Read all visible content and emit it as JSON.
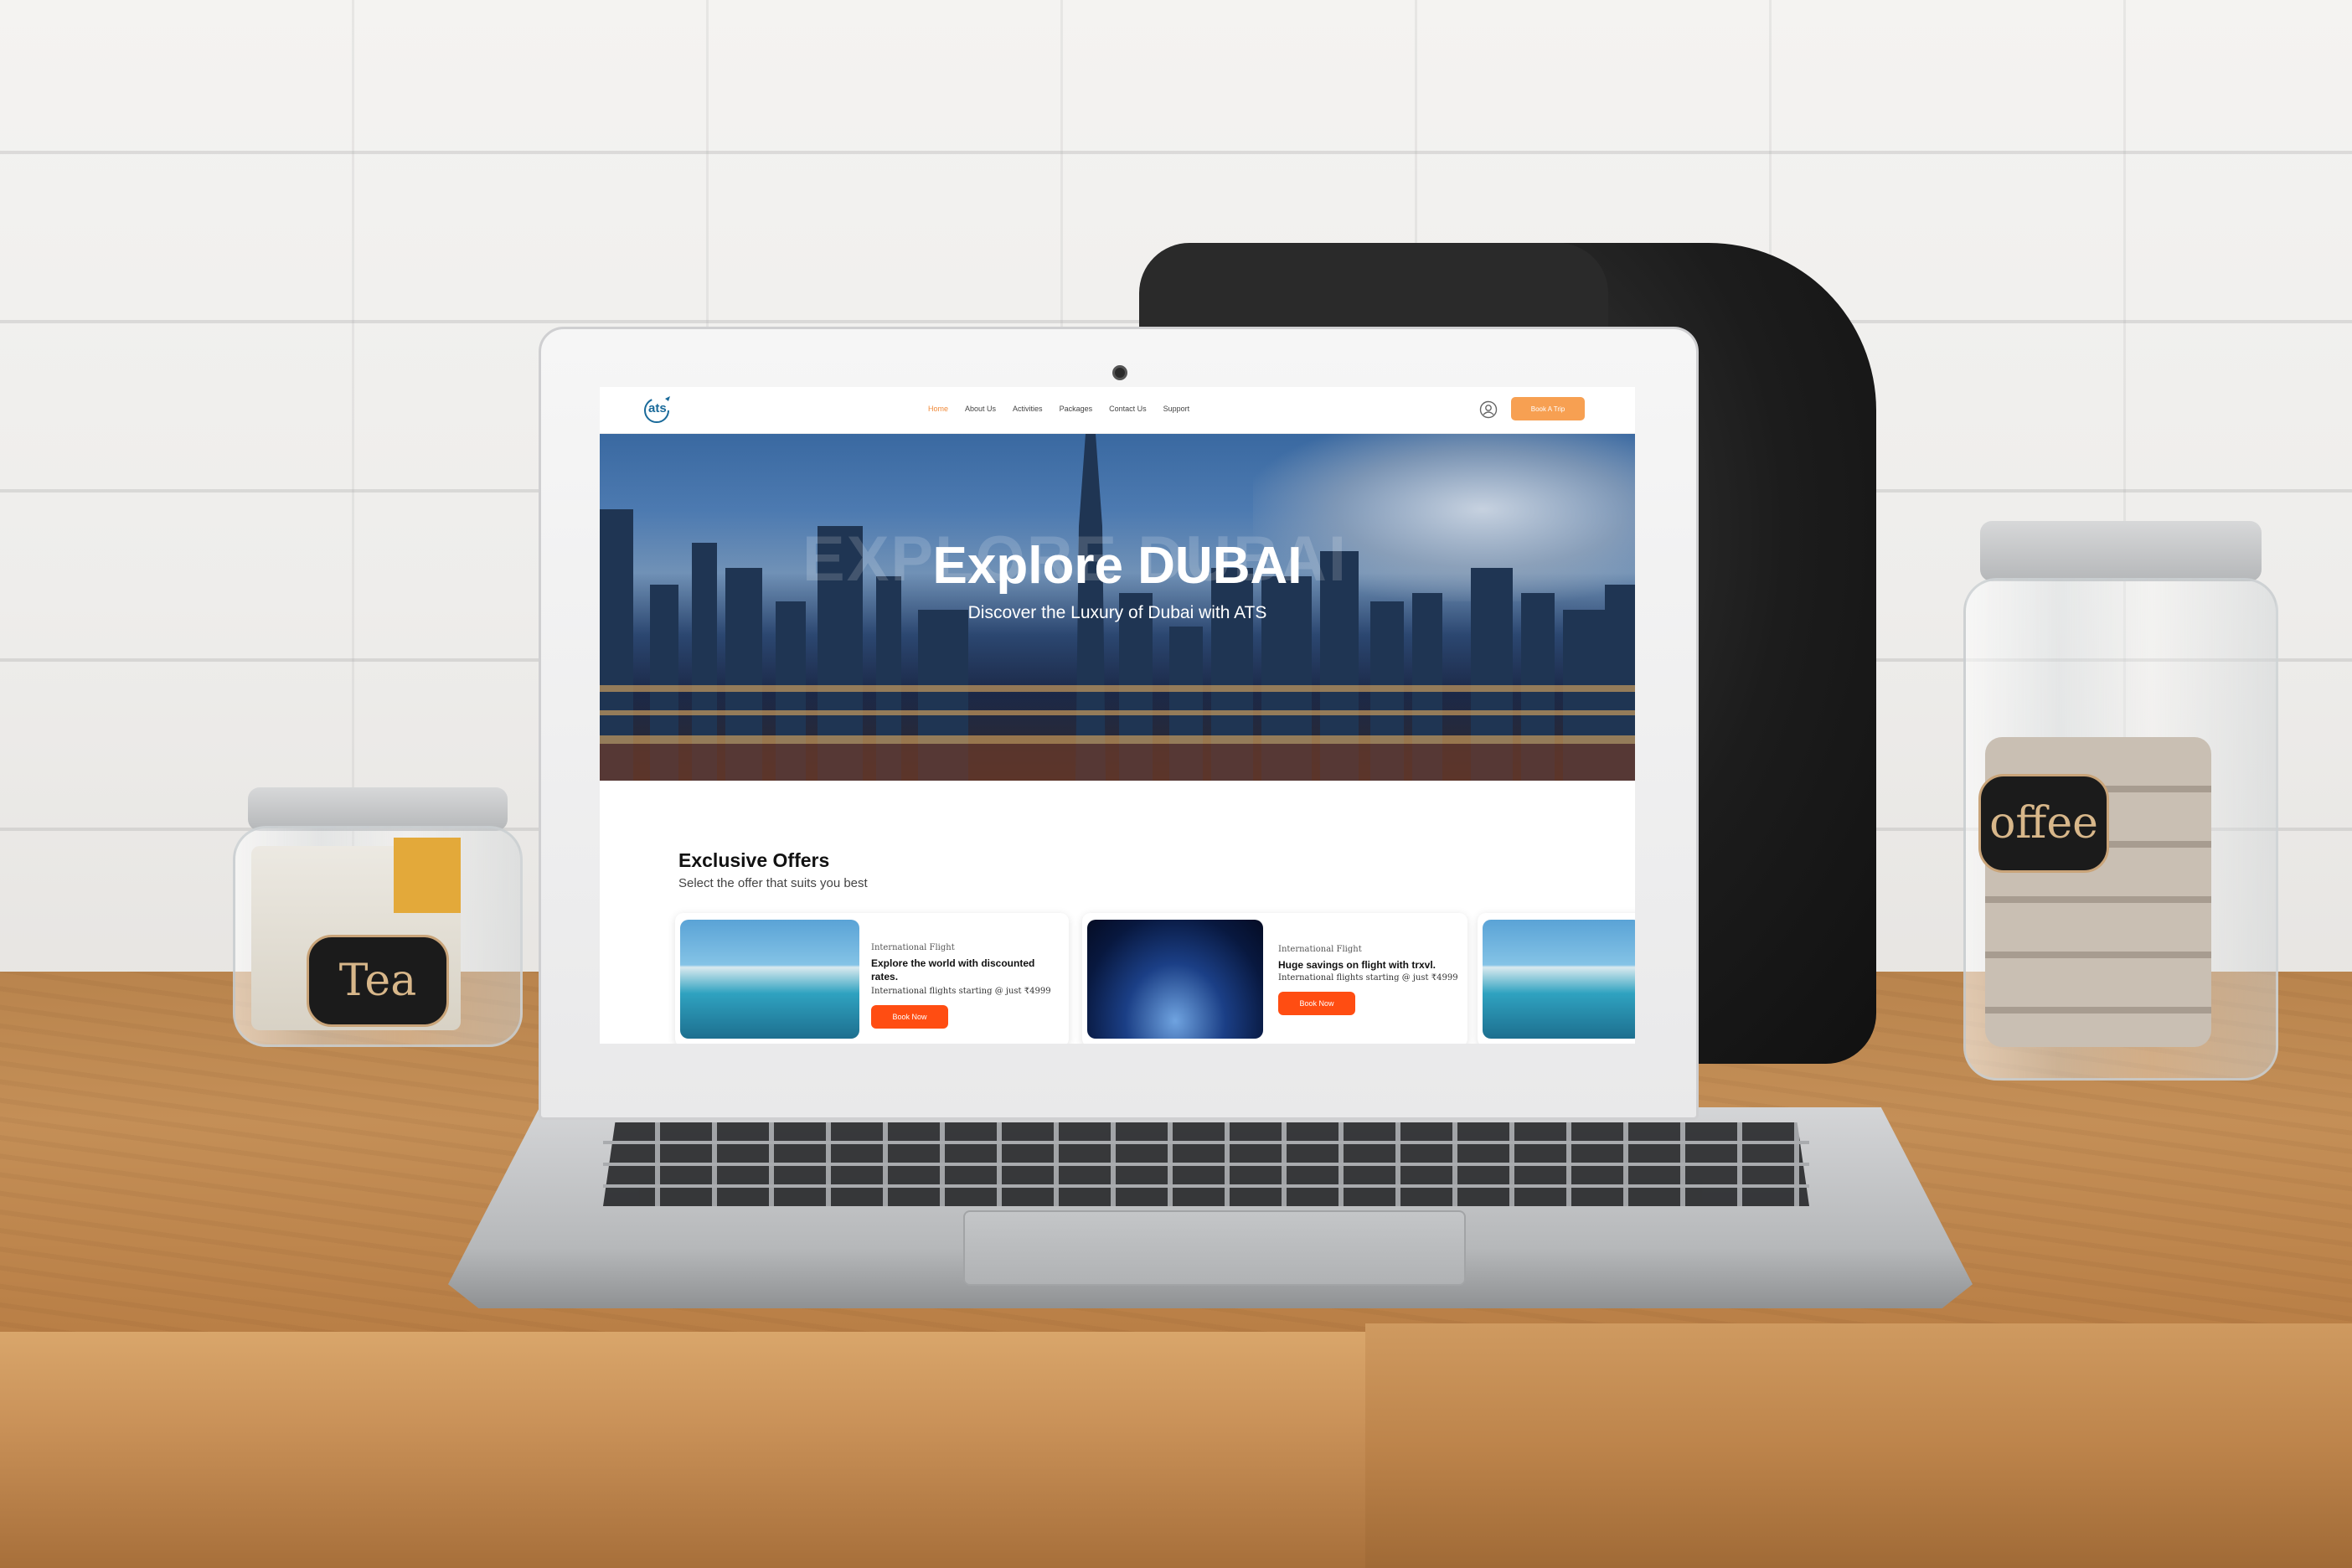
{
  "site": {
    "logo_text": "ats",
    "nav": [
      {
        "label": "Home",
        "active": true
      },
      {
        "label": "About Us",
        "active": false
      },
      {
        "label": "Activities",
        "active": false
      },
      {
        "label": "Packages",
        "active": false
      },
      {
        "label": "Contact Us",
        "active": false
      },
      {
        "label": "Support",
        "active": false
      }
    ],
    "user_icon": "user-circle-icon",
    "cta_label": "Book A Trip"
  },
  "hero": {
    "background_text": "EXPLORE DUBAI",
    "title": "Explore DUBAI",
    "subtitle": "Discover the Luxury of Dubai with ATS"
  },
  "offers": {
    "title": "Exclusive Offers",
    "subtitle": "Select the offer that suits you best",
    "cards": [
      {
        "image": "infinity-pool-photo",
        "kicker": "International Flight",
        "heading": "Explore the world with discounted rates.",
        "price_text": "International flights starting @ just ₹4999",
        "button": "Book Now"
      },
      {
        "image": "airplane-wing-sky-photo",
        "kicker": "International Flight",
        "heading": "Huge savings on flight with trxvl.",
        "price_text": "International flights starting @ just ₹4999",
        "button": "Book Now"
      },
      {
        "image": "infinity-pool-photo"
      }
    ]
  },
  "scene": {
    "jar_left_label": "Tea",
    "jar_right_label": "offee"
  },
  "colors": {
    "accent_orange": "#f7a052",
    "button_red_orange": "#ff4d12",
    "active_nav": "#f08a3a",
    "logo_blue": "#1a6a9a"
  }
}
